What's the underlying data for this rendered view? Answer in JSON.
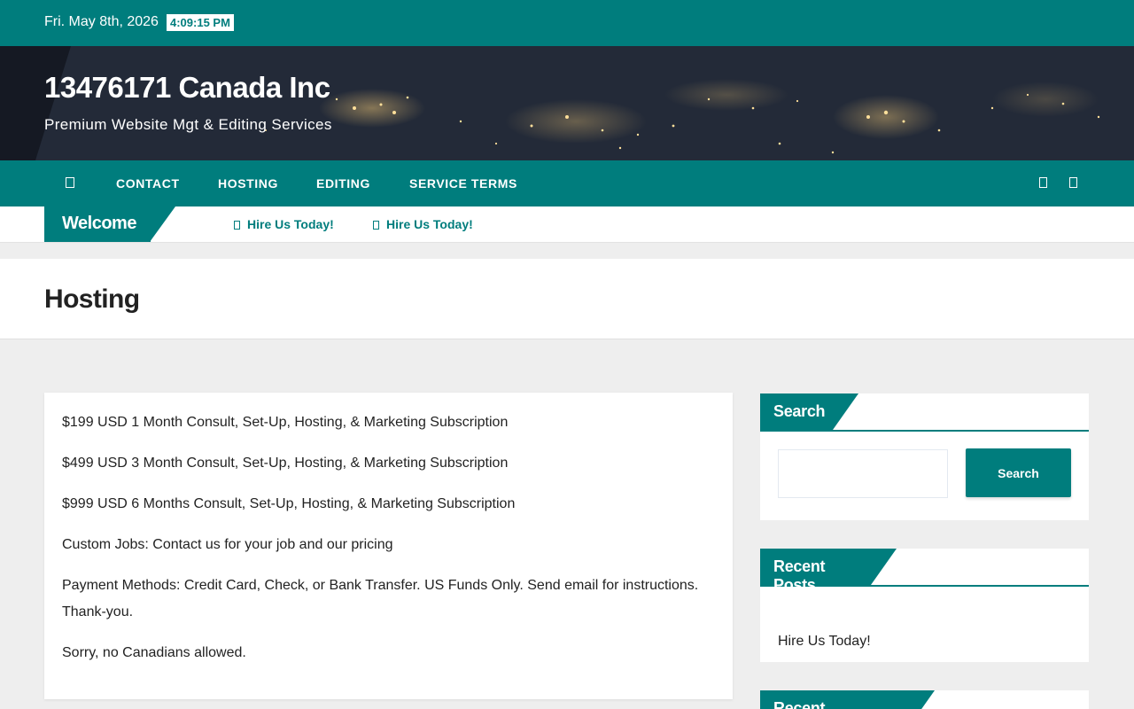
{
  "topbar": {
    "date": "Fri. May 8th, 2026",
    "time": "4:09:15 PM"
  },
  "site": {
    "title": "13476171 Canada Inc",
    "description": "Premium Website Mgt & Editing Services"
  },
  "nav": {
    "home_icon": "home-icon",
    "items": [
      {
        "label": "CONTACT"
      },
      {
        "label": "HOSTING"
      },
      {
        "label": "EDITING"
      },
      {
        "label": "SERVICE TERMS"
      }
    ],
    "right_icons": [
      "search-icon",
      "user-icon"
    ]
  },
  "ticker": {
    "label": "Welcome",
    "items": [
      {
        "icon": "clock-icon",
        "text": "Hire Us Today!"
      },
      {
        "icon": "clock-icon",
        "text": "Hire Us Today!"
      }
    ]
  },
  "page": {
    "title": "Hosting"
  },
  "content": {
    "paragraphs": [
      "$199 USD 1 Month Consult, Set-Up, Hosting, & Marketing Subscription",
      "$499 USD 3 Month Consult, Set-Up, Hosting, & Marketing Subscription",
      "$999 USD 6 Months Consult, Set-Up, Hosting, & Marketing Subscription",
      "Custom Jobs: Contact us for your job and our pricing",
      "Payment Methods: Credit Card, Check, or Bank Transfer. US Funds Only. Send email for instructions. Thank-you.",
      "Sorry, no Canadians allowed."
    ]
  },
  "sidebar": {
    "search": {
      "title": "Search",
      "placeholder": "",
      "button_label": "Search"
    },
    "recent_posts": {
      "title": "Recent Posts",
      "items": [
        {
          "label": "Hire Us Today!"
        }
      ]
    },
    "recent_comments": {
      "title": "Recent Comments"
    }
  },
  "colors": {
    "accent": "#007d7d",
    "background": "#eeeeee",
    "text": "#222222"
  }
}
